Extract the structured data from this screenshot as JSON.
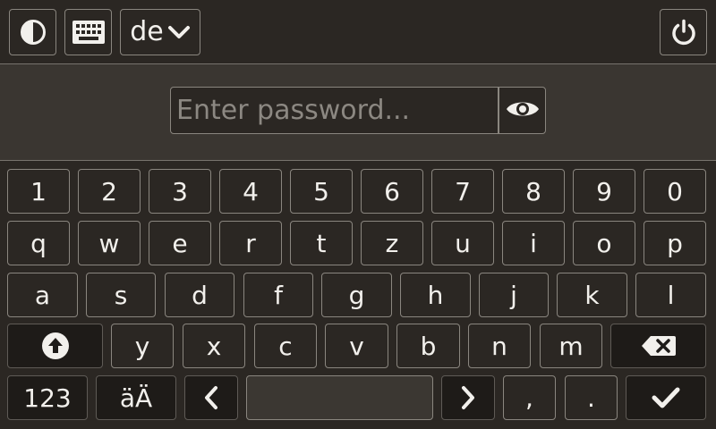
{
  "topbar": {
    "contrast_icon": "contrast-icon",
    "keyboard_icon": "keyboard-icon",
    "language": "de",
    "language_dropdown_icon": "chevron-down-icon",
    "power_icon": "power-icon"
  },
  "password": {
    "placeholder": "Enter password...",
    "value": "",
    "reveal_icon": "eye-icon"
  },
  "keyboard": {
    "row1": [
      "1",
      "2",
      "3",
      "4",
      "5",
      "6",
      "7",
      "8",
      "9",
      "0"
    ],
    "row2": [
      "q",
      "w",
      "e",
      "r",
      "t",
      "z",
      "u",
      "i",
      "o",
      "p"
    ],
    "row3": [
      "a",
      "s",
      "d",
      "f",
      "g",
      "h",
      "j",
      "k",
      "l"
    ],
    "row4": [
      "y",
      "x",
      "c",
      "v",
      "b",
      "n",
      "m"
    ],
    "shift_icon": "shift-arrow-up-icon",
    "backspace_icon": "backspace-icon",
    "numbers_label": "123",
    "umlaut_label": "äÄ",
    "left_icon": "chevron-left-icon",
    "right_icon": "chevron-right-icon",
    "comma_label": ",",
    "period_label": ".",
    "enter_icon": "checkmark-icon"
  }
}
